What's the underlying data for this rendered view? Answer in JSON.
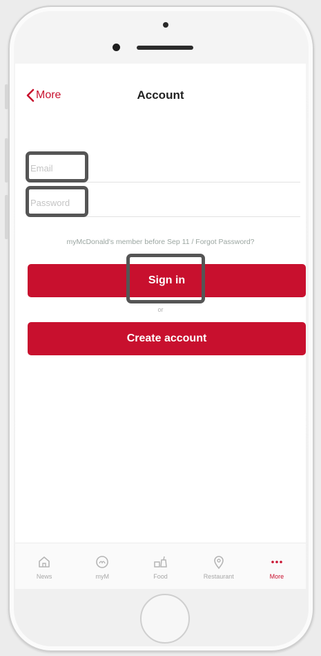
{
  "nav": {
    "back_label": "More",
    "title": "Account"
  },
  "form": {
    "email_placeholder": "Email",
    "password_placeholder": "Password",
    "hint": "myMcDonald's member before Sep 11 / Forgot Password?",
    "signin_label": "Sign in",
    "or_label": "or",
    "create_label": "Create account"
  },
  "tabs": [
    {
      "label": "News",
      "icon": "home-icon",
      "active": false
    },
    {
      "label": "myM",
      "icon": "mym-icon",
      "active": false
    },
    {
      "label": "Food",
      "icon": "food-icon",
      "active": false
    },
    {
      "label": "Restaurant",
      "icon": "location-pin-icon",
      "active": false
    },
    {
      "label": "More",
      "icon": "more-dots-icon",
      "active": true
    }
  ],
  "colors": {
    "brand_red": "#c8102e",
    "highlight_box": "#555555"
  }
}
